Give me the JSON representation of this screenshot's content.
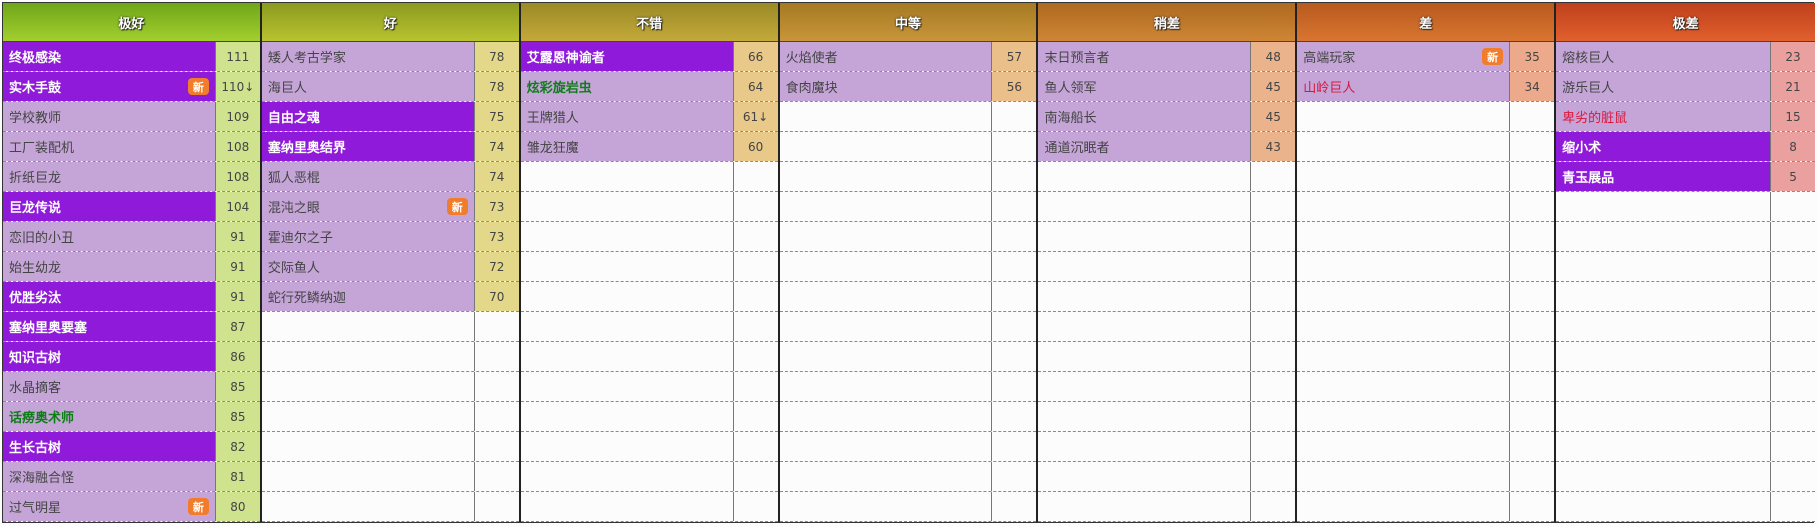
{
  "tiers": [
    {
      "title": "极好",
      "header_gradient": [
        "#6fa61a",
        "#a3cf2e"
      ],
      "score_bg": "#cfe38f",
      "rows": [
        {
          "name": "终极感染",
          "score": "111",
          "style": "epic"
        },
        {
          "name": "实木手鼓",
          "score": "110↓",
          "style": "epic",
          "badge": "新"
        },
        {
          "name": "学校教师",
          "score": "109",
          "style": "normal"
        },
        {
          "name": "工厂装配机",
          "score": "108",
          "style": "normal"
        },
        {
          "name": "折纸巨龙",
          "score": "108",
          "style": "normal"
        },
        {
          "name": "巨龙传说",
          "score": "104",
          "style": "epic"
        },
        {
          "name": "恋旧的小丑",
          "score": "91",
          "style": "normal"
        },
        {
          "name": "始生幼龙",
          "score": "91",
          "style": "normal"
        },
        {
          "name": "优胜劣汰",
          "score": "91",
          "style": "epic"
        },
        {
          "name": "塞纳里奥要塞",
          "score": "87",
          "style": "epic"
        },
        {
          "name": "知识古树",
          "score": "86",
          "style": "epic"
        },
        {
          "name": "水晶摘客",
          "score": "85",
          "style": "normal"
        },
        {
          "name": "话痨奥术师",
          "score": "85",
          "style": "epic-green"
        },
        {
          "name": "生长古树",
          "score": "82",
          "style": "epic"
        },
        {
          "name": "深海融合怪",
          "score": "81",
          "style": "normal"
        },
        {
          "name": "过气明星",
          "score": "80",
          "style": "normal",
          "badge": "新"
        }
      ]
    },
    {
      "title": "好",
      "header_gradient": [
        "#8b9a20",
        "#b8c32e"
      ],
      "score_bg": "#e3d88a",
      "rows": [
        {
          "name": "矮人考古学家",
          "score": "78",
          "style": "normal"
        },
        {
          "name": "海巨人",
          "score": "78",
          "style": "normal"
        },
        {
          "name": "自由之魂",
          "score": "75",
          "style": "epic"
        },
        {
          "name": "塞纳里奥结界",
          "score": "74",
          "style": "epic"
        },
        {
          "name": "狐人恶棍",
          "score": "74",
          "style": "normal"
        },
        {
          "name": "混沌之眼",
          "score": "73",
          "style": "normal",
          "badge": "新"
        },
        {
          "name": "霍迪尔之子",
          "score": "73",
          "style": "normal"
        },
        {
          "name": "交际鱼人",
          "score": "72",
          "style": "normal"
        },
        {
          "name": "蛇行死鳞纳迦",
          "score": "70",
          "style": "normal"
        }
      ]
    },
    {
      "title": "不错",
      "header_gradient": [
        "#9a8a25",
        "#c4a93a"
      ],
      "score_bg": "#e8c98a",
      "rows": [
        {
          "name": "艾露恩神谕者",
          "score": "66",
          "style": "epic"
        },
        {
          "name": "炫彩旋岩虫",
          "score": "64",
          "style": "epic-green"
        },
        {
          "name": "王牌猎人",
          "score": "61↓",
          "style": "normal"
        },
        {
          "name": "雏龙狂魔",
          "score": "60",
          "style": "normal"
        }
      ]
    },
    {
      "title": "中等",
      "header_gradient": [
        "#a57a22",
        "#c9953a"
      ],
      "score_bg": "#eabf8a",
      "rows": [
        {
          "name": "火焰使者",
          "score": "57",
          "style": "normal"
        },
        {
          "name": "食肉魔块",
          "score": "56",
          "style": "normal"
        }
      ]
    },
    {
      "title": "稍差",
      "header_gradient": [
        "#ad6a20",
        "#cf8535"
      ],
      "score_bg": "#ebb38c",
      "rows": [
        {
          "name": "末日预言者",
          "score": "48",
          "style": "normal"
        },
        {
          "name": "鱼人领军",
          "score": "45",
          "style": "normal"
        },
        {
          "name": "南海船长",
          "score": "45",
          "style": "normal"
        },
        {
          "name": "通道沉眠者",
          "score": "43",
          "style": "normal"
        }
      ]
    },
    {
      "title": "差",
      "header_gradient": [
        "#b85a1e",
        "#d97530"
      ],
      "score_bg": "#eca98c",
      "rows": [
        {
          "name": "高端玩家",
          "score": "35",
          "style": "normal",
          "badge": "新"
        },
        {
          "name": "山岭巨人",
          "score": "34",
          "style": "red-text"
        }
      ]
    },
    {
      "title": "极差",
      "header_gradient": [
        "#c0401c",
        "#e0602e"
      ],
      "score_bg": "#eba0a0",
      "rows": [
        {
          "name": "熔核巨人",
          "score": "23",
          "style": "normal"
        },
        {
          "name": "游乐巨人",
          "score": "21",
          "style": "normal"
        },
        {
          "name": "卑劣的脏鼠",
          "score": "15",
          "style": "red-text"
        },
        {
          "name": "缩小术",
          "score": "8",
          "style": "epic"
        },
        {
          "name": "青玉展品",
          "score": "5",
          "style": "epic"
        }
      ]
    }
  ]
}
